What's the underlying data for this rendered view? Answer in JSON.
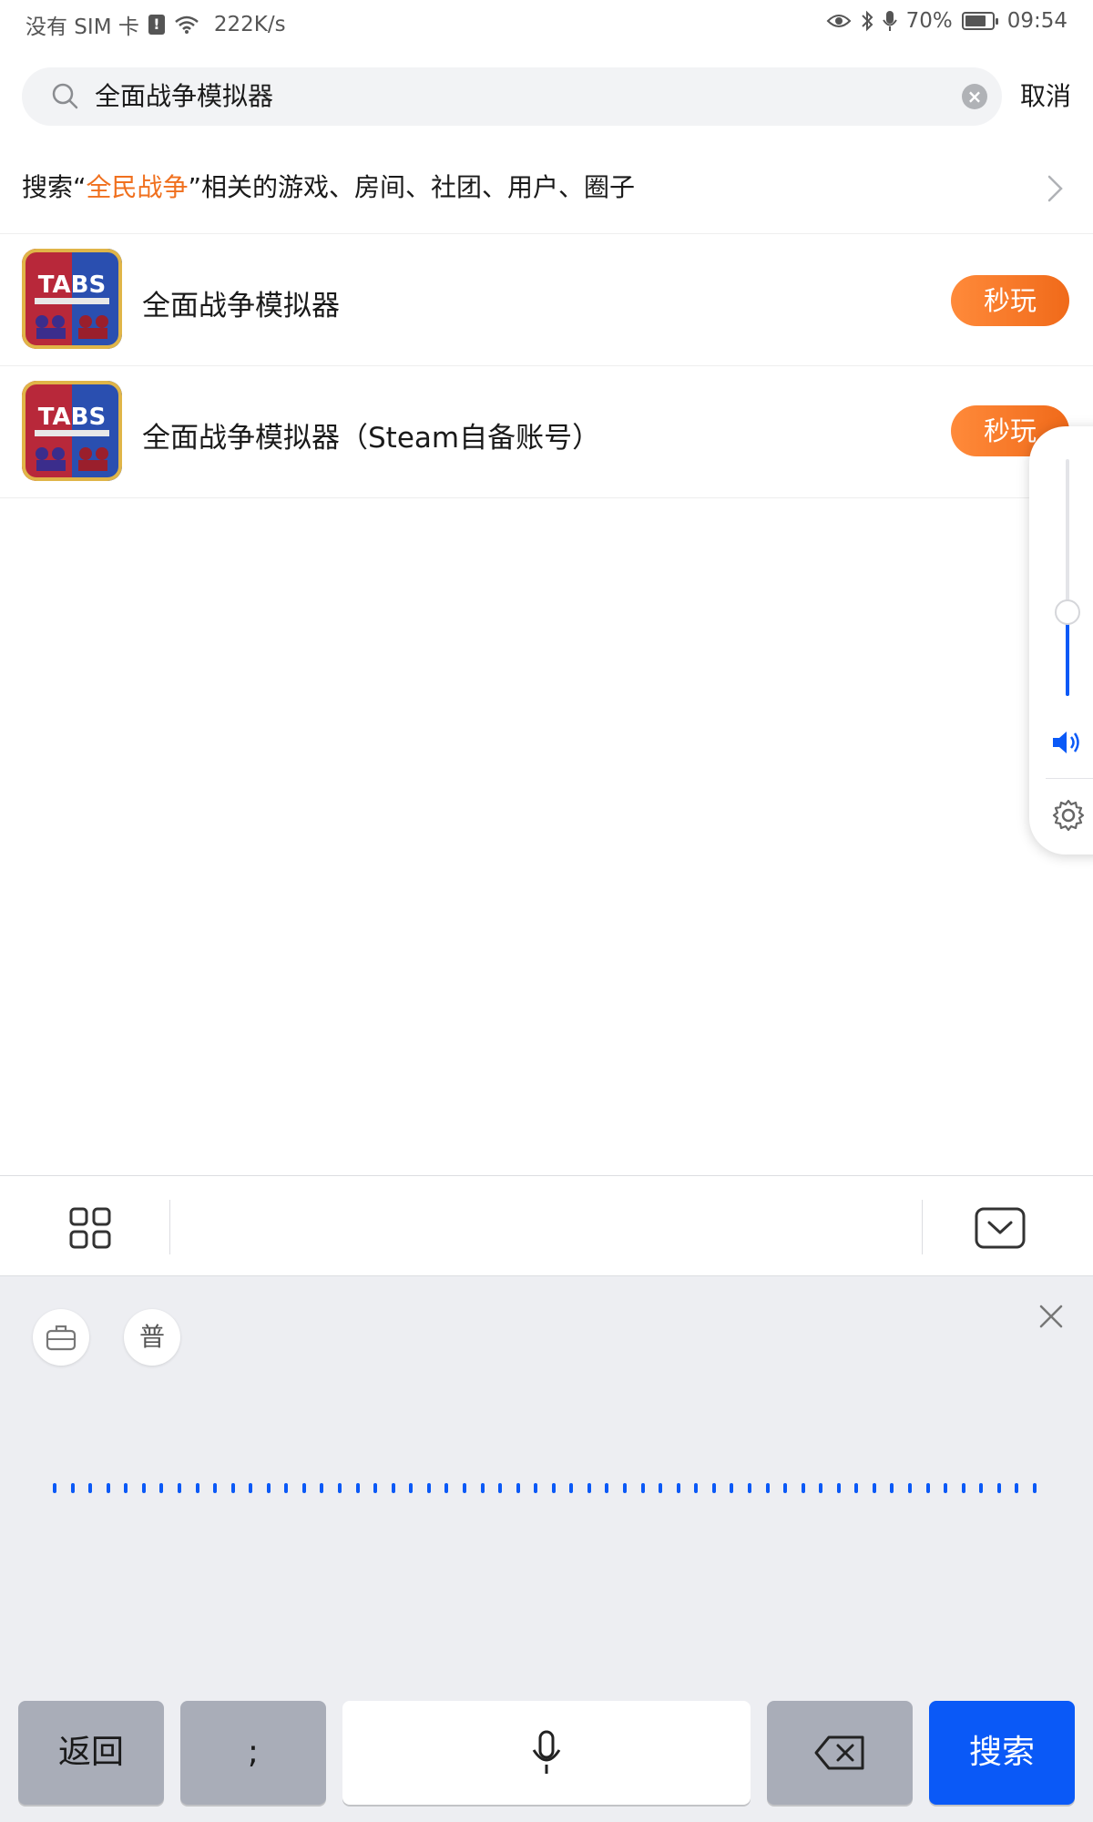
{
  "status_bar": {
    "carrier": "没有 SIM 卡",
    "sim_badge": "!",
    "speed": "222K/s",
    "battery": "70%",
    "time": "09:54"
  },
  "search": {
    "query": "全面战争模拟器",
    "cancel_label": "取消"
  },
  "suggest": {
    "prefix": "搜索“",
    "keyword": "全民战争",
    "suffix": "”相关的游戏、房间、社团、用户、圈子"
  },
  "results": [
    {
      "title": "全面战争模拟器",
      "icon_text": "TABS",
      "button": "秒玩"
    },
    {
      "title": "全面战争模拟器（Steam自备账号）",
      "icon_text": "TABS",
      "button": "秒玩"
    }
  ],
  "keyboard": {
    "mode_badge": "普",
    "keys": {
      "back": "返回",
      "semicolon": ";",
      "search": "搜索"
    }
  },
  "volume": {
    "level": 0.34
  },
  "colors": {
    "accent_blue": "#0a59f7",
    "accent_orange": "#f0701e"
  }
}
